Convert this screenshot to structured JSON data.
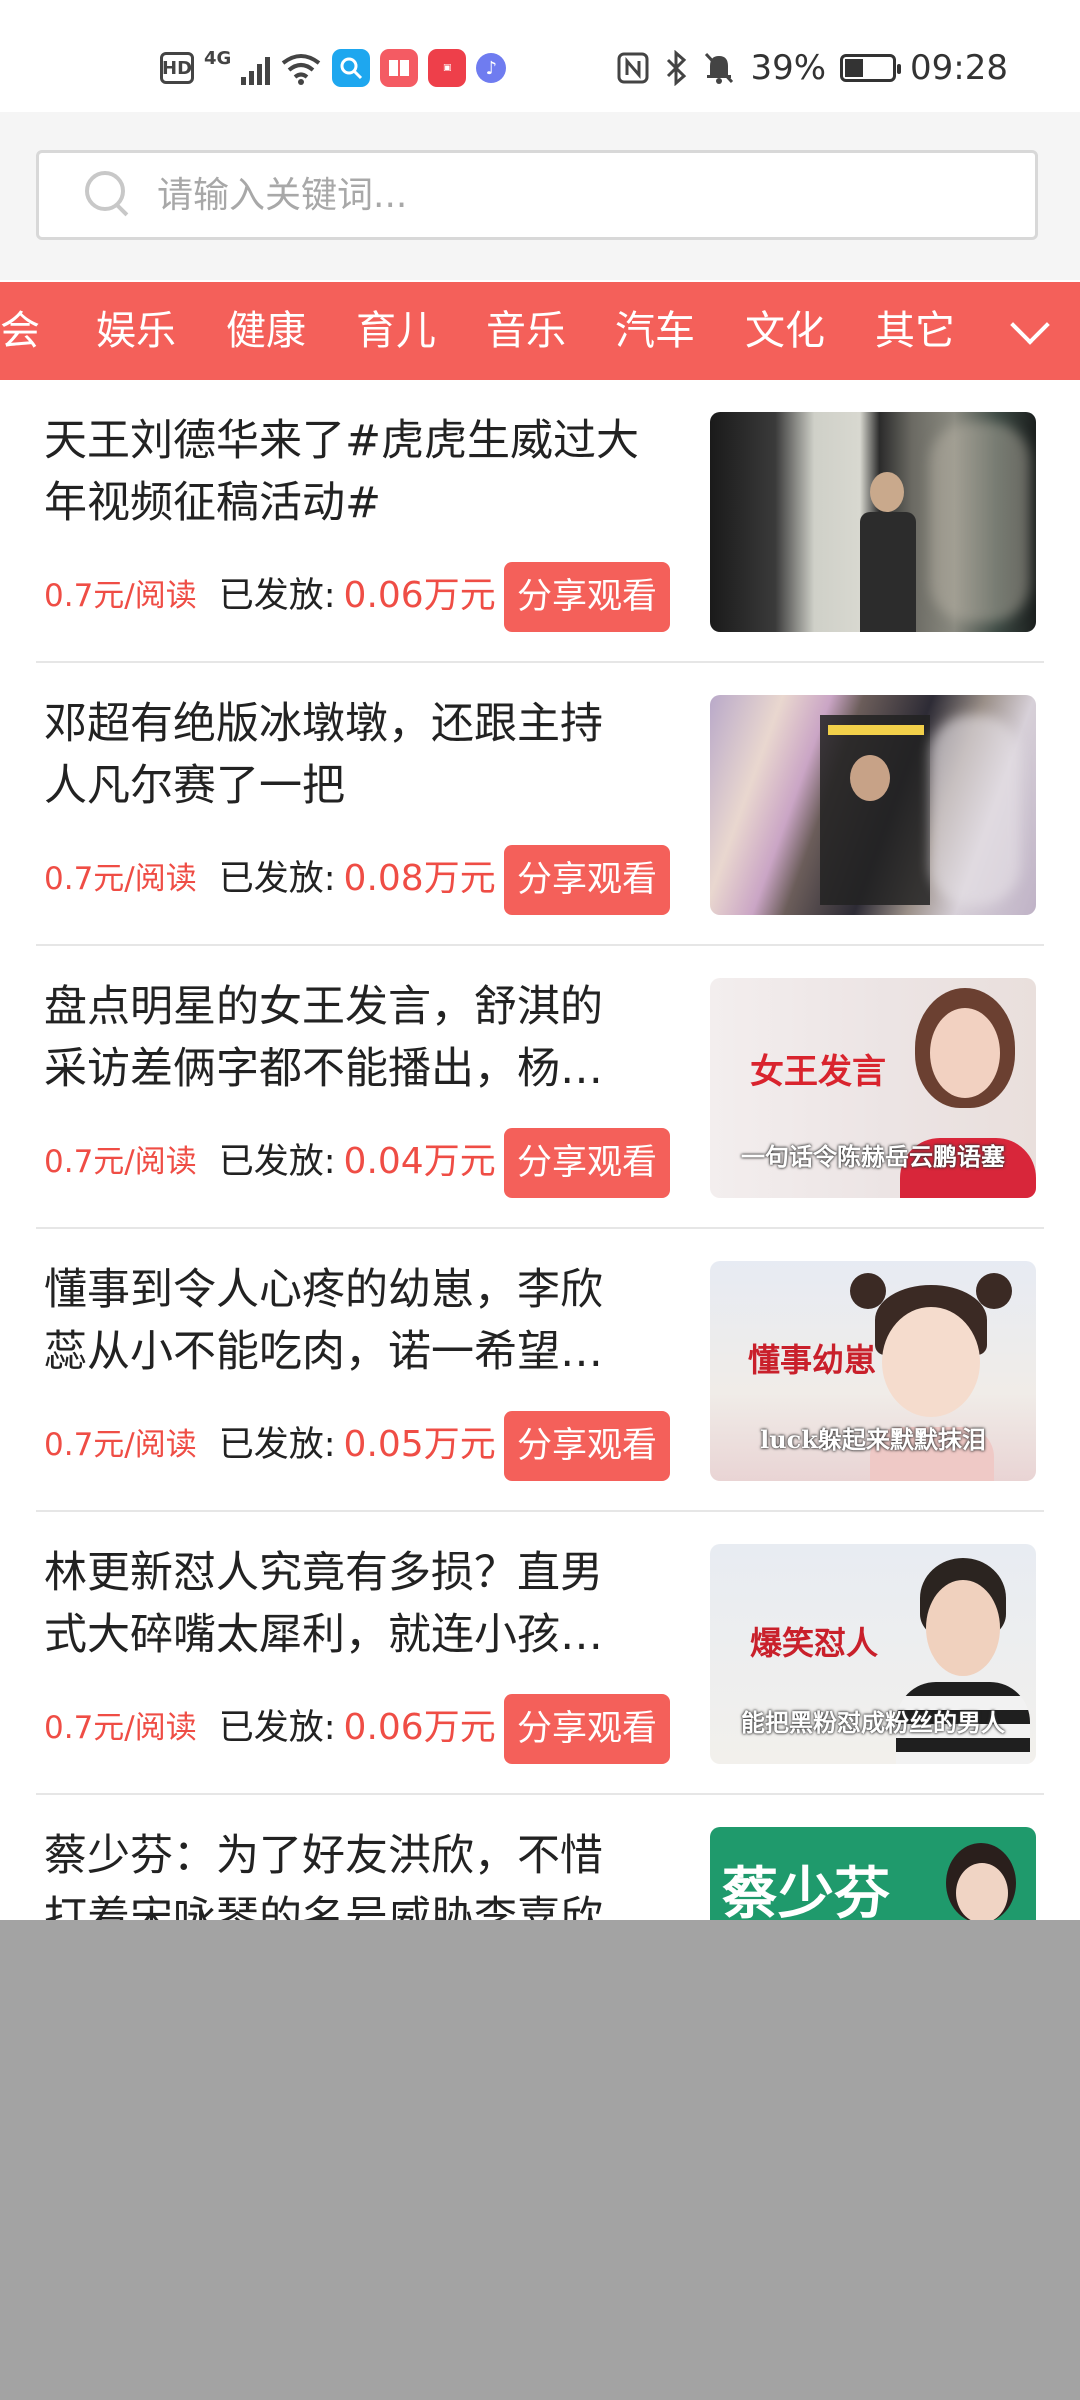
{
  "status_bar": {
    "hd": "HD",
    "network": "4G",
    "battery_percent": "39%",
    "time": "09:28",
    "battery_level": 0.39,
    "icons": [
      "hd-icon",
      "signal-icon",
      "wifi-icon",
      "search-app-icon",
      "reader-app-icon",
      "huawei-app-icon",
      "music-app-icon",
      "nfc-icon",
      "bluetooth-icon",
      "mute-icon",
      "battery-icon"
    ]
  },
  "search": {
    "placeholder": "请输入关键词..."
  },
  "categories": {
    "items": [
      "社会",
      "娱乐",
      "健康",
      "育儿",
      "音乐",
      "汽车",
      "文化",
      "其它"
    ],
    "active_color": "#f4605a"
  },
  "news": [
    {
      "title": "天王刘德华来了#虎虎生威过大年视频征稿活动#",
      "rate": "0.7元/阅读",
      "published_label": "已发放:",
      "published_value": "0.06万元",
      "share_label": "分享观看"
    },
    {
      "title": "邓超有绝版冰墩墩，还跟主持人凡尔赛了一把",
      "rate": "0.7元/阅读",
      "published_label": "已发放:",
      "published_value": "0.08万元",
      "share_label": "分享观看"
    },
    {
      "title": "盘点明星的女王发言，舒淇的采访差俩字都不能播出，杨…",
      "rate": "0.7元/阅读",
      "published_label": "已发放:",
      "published_value": "0.04万元",
      "share_label": "分享观看",
      "thumb_title": "女王发言",
      "thumb_sub": "一句话令陈赫岳云鹏语塞"
    },
    {
      "title": "懂事到令人心疼的幼崽，李欣蕊从小不能吃肉，诺一希望…",
      "rate": "0.7元/阅读",
      "published_label": "已发放:",
      "published_value": "0.05万元",
      "share_label": "分享观看",
      "thumb_title": "懂事幼崽",
      "thumb_sub": "luck躲起来默默抹泪"
    },
    {
      "title": "林更新怼人究竟有多损？直男式大碎嘴太犀利，就连小孩…",
      "rate": "0.7元/阅读",
      "published_label": "已发放:",
      "published_value": "0.06万元",
      "share_label": "分享观看",
      "thumb_title": "爆笑怼人",
      "thumb_sub": "能把黑粉怼成粉丝的男人"
    },
    {
      "title": "蔡少芬：为了好友洪欣，不惜打着宋咏琴的名号威胁李嘉欣",
      "thumb_title": "蔡少芬"
    }
  ]
}
